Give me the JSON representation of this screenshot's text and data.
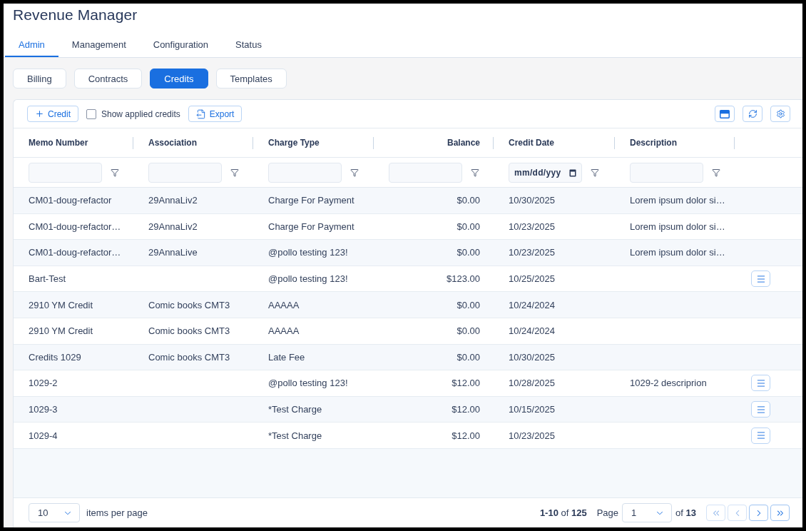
{
  "app": {
    "title": "Revenue Manager"
  },
  "tabs": [
    {
      "label": "Admin",
      "selected": true
    },
    {
      "label": "Management",
      "selected": false
    },
    {
      "label": "Configuration",
      "selected": false
    },
    {
      "label": "Status",
      "selected": false
    }
  ],
  "subtabs": [
    {
      "label": "Billing",
      "selected": false
    },
    {
      "label": "Contracts",
      "selected": false
    },
    {
      "label": "Credits",
      "selected": true
    },
    {
      "label": "Templates",
      "selected": false
    }
  ],
  "toolbar": {
    "add_button": "Credit",
    "show_applied": {
      "label": "Show applied credits",
      "checked": false
    },
    "export_button": "Export"
  },
  "table": {
    "columns": [
      {
        "label": "Memo Number",
        "kind": "text"
      },
      {
        "label": "Association",
        "kind": "text"
      },
      {
        "label": "Charge Type",
        "kind": "text"
      },
      {
        "label": "Balance",
        "kind": "amount"
      },
      {
        "label": "Credit Date",
        "kind": "date",
        "placeholder": "mm/dd/yyy"
      },
      {
        "label": "Description",
        "kind": "text"
      }
    ],
    "rows": [
      {
        "memo_number": "CM01-doug-refactor",
        "association": "29AnnaLiv2",
        "charge_type": "Charge For Payment",
        "balance": "$0.00",
        "credit_date": "10/30/2025",
        "description": "Lorem ipsum dolor si…",
        "menu_button": false
      },
      {
        "memo_number": "CM01-doug-refactor…",
        "association": "29AnnaLiv2",
        "charge_type": "Charge For Payment",
        "balance": "$0.00",
        "credit_date": "10/23/2025",
        "description": "Lorem ipsum dolor si…",
        "menu_button": false
      },
      {
        "memo_number": "CM01-doug-refactor…",
        "association": "29AnnaLive",
        "charge_type": "@pollo testing 123!",
        "balance": "$0.00",
        "credit_date": "10/23/2025",
        "description": "Lorem ipsum dolor si…",
        "menu_button": false
      },
      {
        "memo_number": "Bart-Test",
        "charge_type": "@pollo testing 123!",
        "balance": "$123.00",
        "credit_date": "10/25/2025",
        "menu_button": true
      },
      {
        "memo_number": "2910 YM Credit",
        "association": "Comic books CMT3",
        "charge_type": "AAAAA",
        "balance": "$0.00",
        "credit_date": "10/24/2024",
        "menu_button": false
      },
      {
        "memo_number": "2910 YM Credit",
        "association": "Comic books CMT3",
        "charge_type": "AAAAA",
        "balance": "$0.00",
        "credit_date": "10/24/2024",
        "menu_button": false
      },
      {
        "memo_number": "Credits 1029",
        "association": "Comic books CMT3",
        "charge_type": "Late Fee",
        "balance": "$0.00",
        "credit_date": "10/30/2025",
        "menu_button": false
      },
      {
        "memo_number": "1029-2",
        "charge_type": "@pollo testing 123!",
        "balance": "$12.00",
        "credit_date": "10/28/2025",
        "description": "1029-2 descriprion",
        "menu_button": true
      },
      {
        "memo_number": "1029-3",
        "charge_type": "*Test Charge",
        "balance": "$12.00",
        "credit_date": "10/15/2025",
        "menu_button": true
      },
      {
        "memo_number": "1029-4",
        "charge_type": "*Test Charge",
        "balance": "$12.00",
        "credit_date": "10/23/2025",
        "menu_button": true
      }
    ]
  },
  "pagination": {
    "page_size": "10",
    "page_size_label": "items per page",
    "range": "**1-10** of **125**",
    "page_label": "Page",
    "page": "1",
    "page_count": "of **13**",
    "nav": [
      {
        "kind": "first",
        "disabled": true
      },
      {
        "kind": "prev",
        "disabled": true
      },
      {
        "kind": "next",
        "disabled": false
      },
      {
        "kind": "last",
        "disabled": false
      }
    ]
  }
}
